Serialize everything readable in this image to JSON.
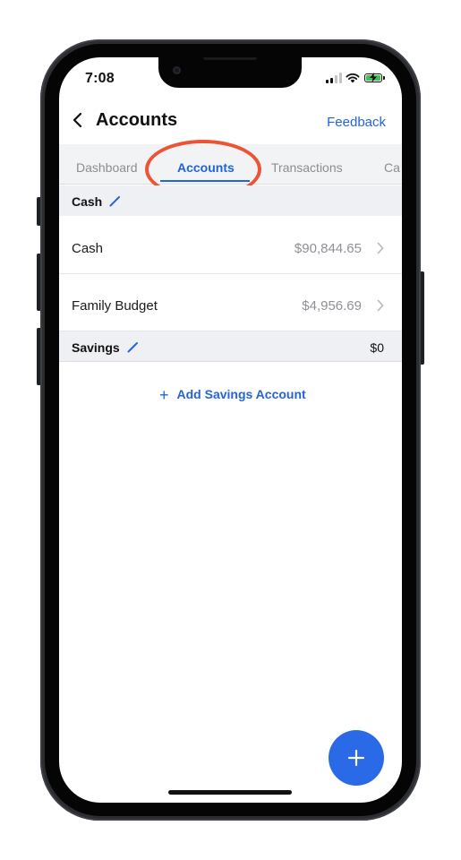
{
  "status_bar": {
    "time": "7:08",
    "icons": [
      "cellular-signal-icon",
      "wifi-icon",
      "battery-charging-icon"
    ],
    "battery_color": "#3ec154"
  },
  "header": {
    "back_icon": "chevron-left-icon",
    "title": "Accounts",
    "feedback_label": "Feedback"
  },
  "tabs": [
    {
      "label": "Dashboard",
      "active": false
    },
    {
      "label": "Accounts",
      "active": true
    },
    {
      "label": "Transactions",
      "active": false
    },
    {
      "label": "Ca",
      "active": false
    }
  ],
  "sections": {
    "cash": {
      "label": "Cash",
      "edit_icon": "pencil-icon",
      "rows": [
        {
          "name": "Cash",
          "amount": "$90,844.65"
        },
        {
          "name": "Family Budget",
          "amount": "$4,956.69"
        }
      ]
    },
    "savings": {
      "label": "Savings",
      "edit_icon": "pencil-icon",
      "total": "$0"
    }
  },
  "add_savings": {
    "label": "Add Savings Account"
  },
  "fab": {
    "icon": "plus-icon"
  },
  "colors": {
    "accent": "#2563d9",
    "highlight": "#ec5435",
    "fab": "#2b6ae6"
  }
}
